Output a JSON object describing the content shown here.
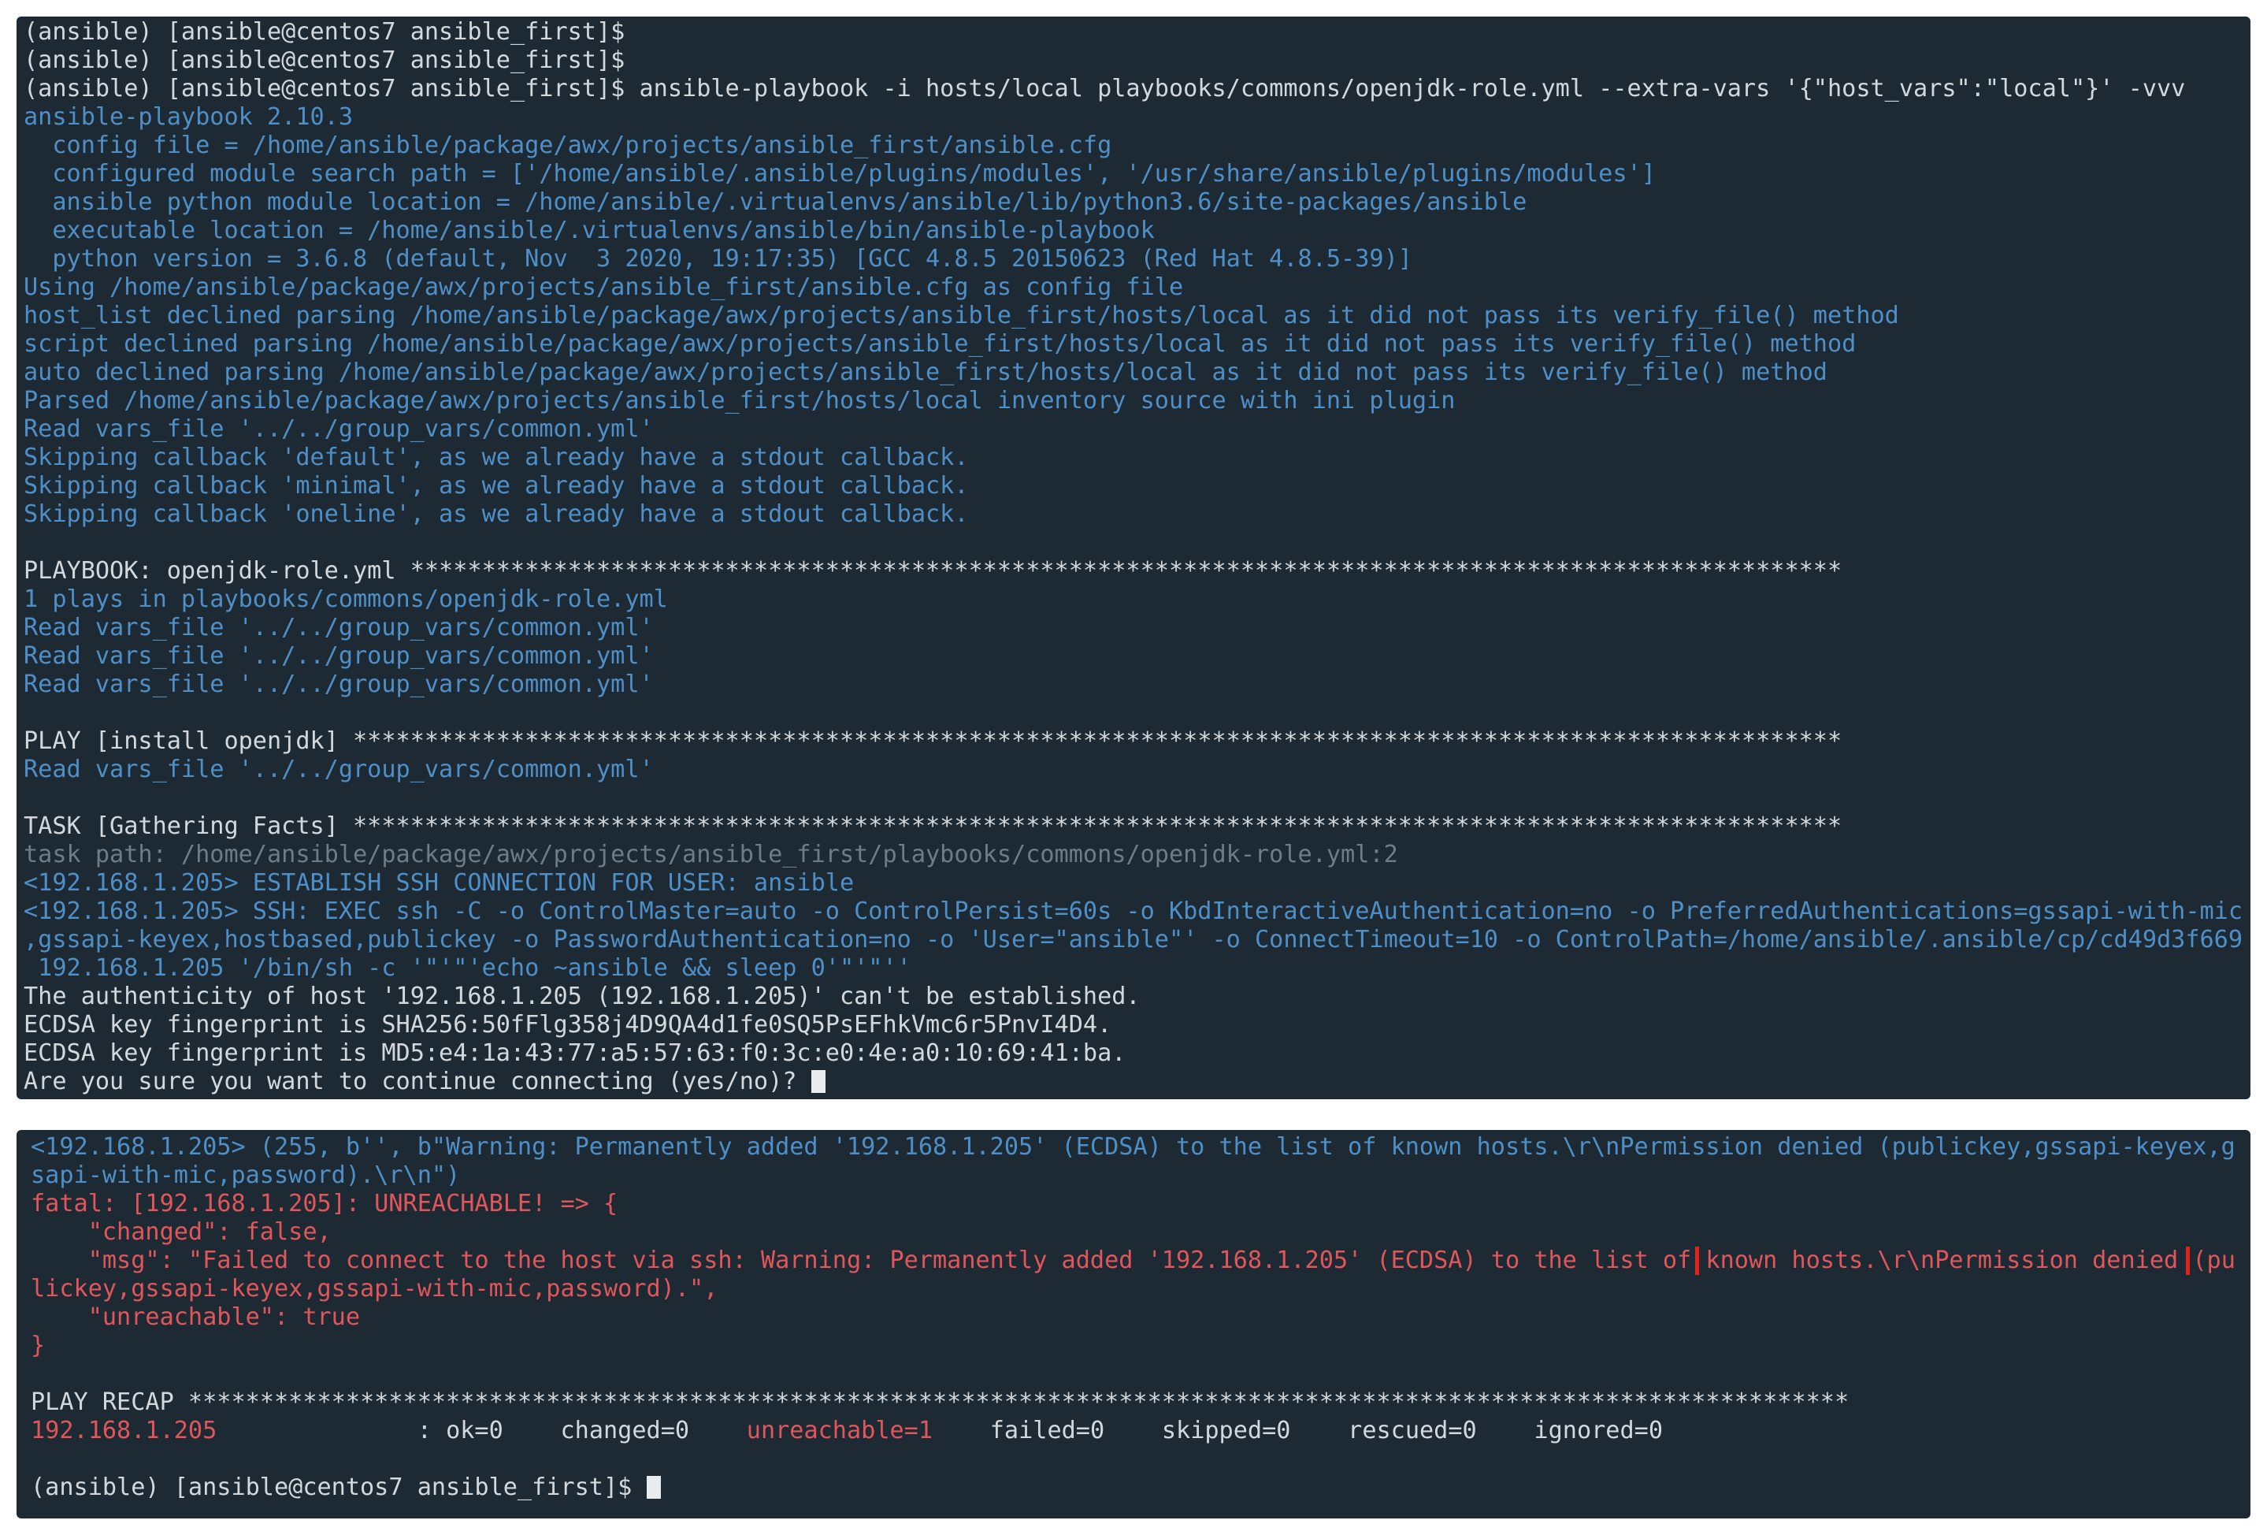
{
  "colors": {
    "terminal_bg": "#1e2a33",
    "text_white": "#d3d8dc",
    "text_blue": "#4f8fc7",
    "text_grey": "#6f7c86",
    "text_red": "#e0565b",
    "highlight_box": "#e0221b"
  },
  "top": {
    "lines": [
      {
        "c": "white",
        "t": "(ansible) [ansible@centos7 ansible_first]$"
      },
      {
        "c": "white",
        "t": "(ansible) [ansible@centos7 ansible_first]$"
      },
      {
        "c": "white",
        "t": "(ansible) [ansible@centos7 ansible_first]$ ansible-playbook -i hosts/local playbooks/commons/openjdk-role.yml --extra-vars '{\"host_vars\":\"local\"}' -vvv"
      },
      {
        "c": "blue",
        "t": "ansible-playbook 2.10.3"
      },
      {
        "c": "blue",
        "t": "  config file = /home/ansible/package/awx/projects/ansible_first/ansible.cfg"
      },
      {
        "c": "blue",
        "t": "  configured module search path = ['/home/ansible/.ansible/plugins/modules', '/usr/share/ansible/plugins/modules']"
      },
      {
        "c": "blue",
        "t": "  ansible python module location = /home/ansible/.virtualenvs/ansible/lib/python3.6/site-packages/ansible"
      },
      {
        "c": "blue",
        "t": "  executable location = /home/ansible/.virtualenvs/ansible/bin/ansible-playbook"
      },
      {
        "c": "blue",
        "t": "  python version = 3.6.8 (default, Nov  3 2020, 19:17:35) [GCC 4.8.5 20150623 (Red Hat 4.8.5-39)]"
      },
      {
        "c": "blue",
        "t": "Using /home/ansible/package/awx/projects/ansible_first/ansible.cfg as config file"
      },
      {
        "c": "blue",
        "t": "host_list declined parsing /home/ansible/package/awx/projects/ansible_first/hosts/local as it did not pass its verify_file() method"
      },
      {
        "c": "blue",
        "t": "script declined parsing /home/ansible/package/awx/projects/ansible_first/hosts/local as it did not pass its verify_file() method"
      },
      {
        "c": "blue",
        "t": "auto declined parsing /home/ansible/package/awx/projects/ansible_first/hosts/local as it did not pass its verify_file() method"
      },
      {
        "c": "blue",
        "t": "Parsed /home/ansible/package/awx/projects/ansible_first/hosts/local inventory source with ini plugin"
      },
      {
        "c": "blue",
        "t": "Read vars_file '../../group_vars/common.yml'"
      },
      {
        "c": "blue",
        "t": "Skipping callback 'default', as we already have a stdout callback."
      },
      {
        "c": "blue",
        "t": "Skipping callback 'minimal', as we already have a stdout callback."
      },
      {
        "c": "blue",
        "t": "Skipping callback 'oneline', as we already have a stdout callback."
      },
      {
        "c": "white",
        "t": ""
      },
      {
        "c": "white",
        "t": "PLAYBOOK: openjdk-role.yml ****************************************************************************************************"
      },
      {
        "c": "blue",
        "t": "1 plays in playbooks/commons/openjdk-role.yml"
      },
      {
        "c": "blue",
        "t": "Read vars_file '../../group_vars/common.yml'"
      },
      {
        "c": "blue",
        "t": "Read vars_file '../../group_vars/common.yml'"
      },
      {
        "c": "blue",
        "t": "Read vars_file '../../group_vars/common.yml'"
      },
      {
        "c": "white",
        "t": ""
      },
      {
        "c": "white",
        "t": "PLAY [install openjdk] ********************************************************************************************************"
      },
      {
        "c": "blue",
        "t": "Read vars_file '../../group_vars/common.yml'"
      },
      {
        "c": "white",
        "t": ""
      },
      {
        "c": "white",
        "t": "TASK [Gathering Facts] ********************************************************************************************************"
      },
      {
        "c": "grey",
        "t": "task path: /home/ansible/package/awx/projects/ansible_first/playbooks/commons/openjdk-role.yml:2"
      },
      {
        "c": "blue",
        "t": "<192.168.1.205> ESTABLISH SSH CONNECTION FOR USER: ansible"
      },
      {
        "c": "blue",
        "t": "<192.168.1.205> SSH: EXEC ssh -C -o ControlMaster=auto -o ControlPersist=60s -o KbdInteractiveAuthentication=no -o PreferredAuthentications=gssapi-with-mic"
      },
      {
        "c": "blue",
        "t": ",gssapi-keyex,hostbased,publickey -o PasswordAuthentication=no -o 'User=\"ansible\"' -o ConnectTimeout=10 -o ControlPath=/home/ansible/.ansible/cp/cd49d3f669"
      },
      {
        "c": "blue",
        "t": " 192.168.1.205 '/bin/sh -c '\"'\"'echo ~ansible && sleep 0'\"'\"''"
      },
      {
        "c": "white",
        "t": "The authenticity of host '192.168.1.205 (192.168.1.205)' can't be established."
      },
      {
        "c": "white",
        "t": "ECDSA key fingerprint is SHA256:50fFlg358j4D9QA4d1fe0SQ5PsEFhkVmc6r5PnvI4D4."
      },
      {
        "c": "white",
        "t": "ECDSA key fingerprint is MD5:e4:1a:43:77:a5:57:63:f0:3c:e0:4e:a0:10:69:41:ba."
      }
    ],
    "prompt_line": "Are you sure you want to continue connecting (yes/no)? "
  },
  "bottom": {
    "warning_lines": [
      "<192.168.1.205> (255, b'', b\"Warning: Permanently added '192.168.1.205' (ECDSA) to the list of known hosts.\\r\\nPermission denied (publickey,gssapi-keyex,gs",
      "sapi-with-mic,password).\\r\\n\")"
    ],
    "fatal_open": "fatal: [192.168.1.205]: UNREACHABLE! => {",
    "changed": "    \"changed\": false,",
    "msg_prefix": "    \"msg\": \"Failed to connect to the host via ssh: Warning: Permanently added '192.168.1.205' (ECDSA) to the list of ",
    "msg_highlight": "known hosts.\\r\\nPermission denied",
    "msg_suffix": " (pub",
    "msg_cont": "lickey,gssapi-keyex,gssapi-with-mic,password).\",",
    "unreachable": "    \"unreachable\": true",
    "fatal_close": "}",
    "recap_header": "PLAY RECAP ********************************************************************************************************************",
    "recap": {
      "host": "192.168.1.205",
      "sep": "              : ",
      "ok": "ok=0",
      "changed": "changed=0",
      "unreachable": "unreachable=1",
      "failed": "failed=0",
      "skipped": "skipped=0",
      "rescued": "rescued=0",
      "ignored": "ignored=0"
    },
    "final_prompt": "(ansible) [ansible@centos7 ansible_first]$ "
  }
}
